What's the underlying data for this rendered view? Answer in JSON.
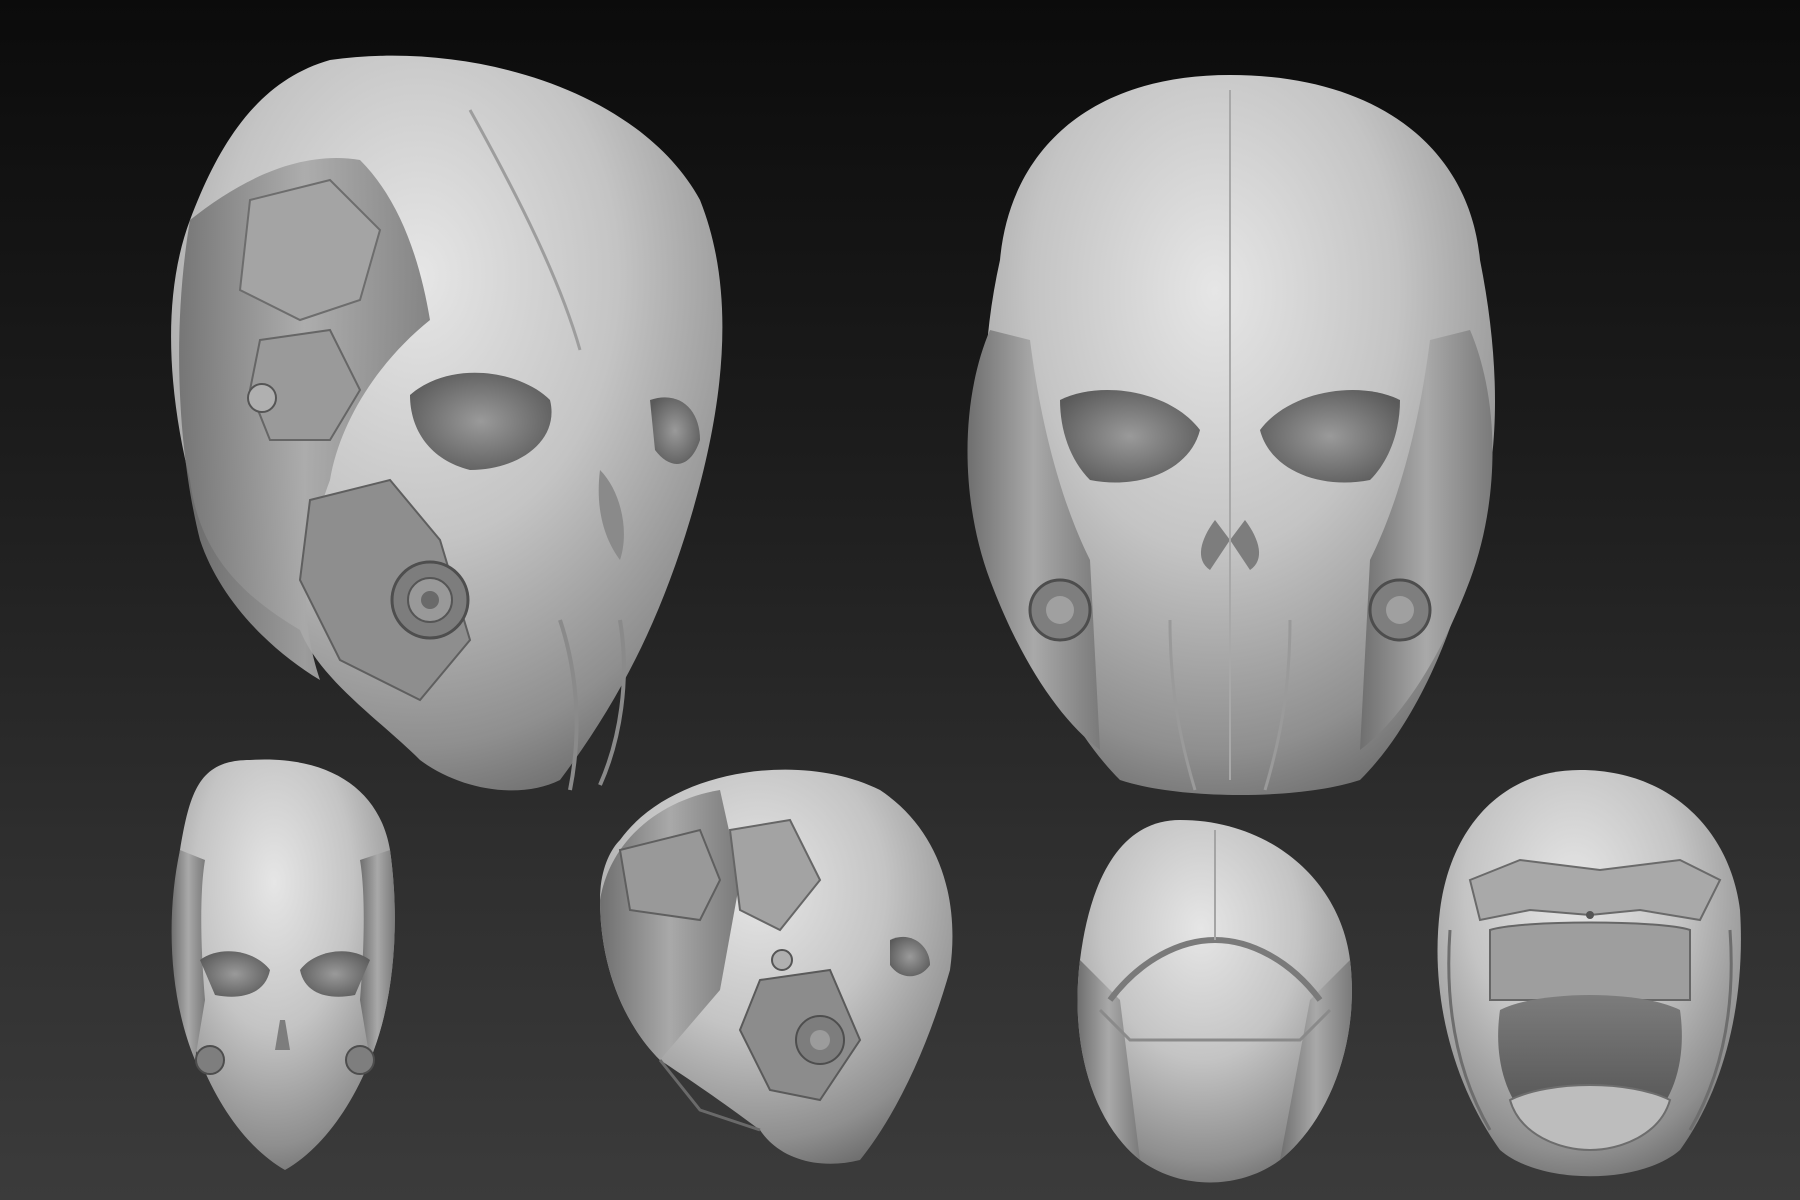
{
  "scene": {
    "background_top": "#0b0b0b",
    "background_bottom": "#3b3b3b",
    "material_color": "#bdbdbd",
    "views": [
      {
        "name": "three-quarter-left"
      },
      {
        "name": "front"
      },
      {
        "name": "front-small"
      },
      {
        "name": "side"
      },
      {
        "name": "top"
      },
      {
        "name": "underside"
      }
    ]
  }
}
